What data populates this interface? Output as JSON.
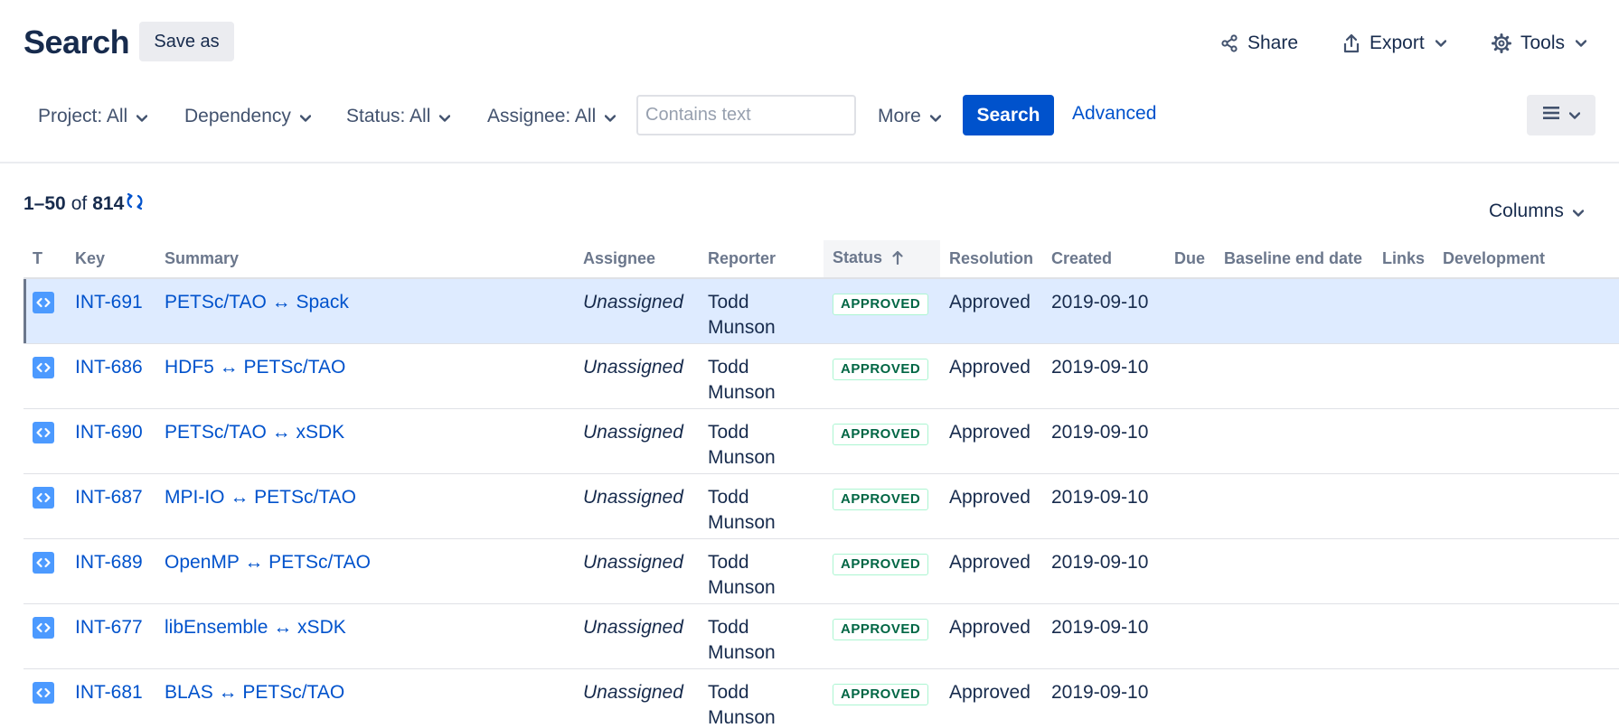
{
  "header": {
    "title": "Search",
    "save_as": "Save as",
    "share": "Share",
    "export": "Export",
    "tools": "Tools"
  },
  "filters": {
    "project": "Project: All",
    "dependency": "Dependency",
    "status": "Status: All",
    "assignee": "Assignee: All",
    "text_placeholder": "Contains text",
    "more": "More",
    "search": "Search",
    "advanced": "Advanced"
  },
  "results": {
    "range": "1–50",
    "of": "of",
    "total": "814",
    "columns_label": "Columns"
  },
  "table": {
    "headers": {
      "type": "T",
      "key": "Key",
      "summary": "Summary",
      "assignee": "Assignee",
      "reporter": "Reporter",
      "status": "Status",
      "resolution": "Resolution",
      "created": "Created",
      "due": "Due",
      "baseline": "Baseline end date",
      "links": "Links",
      "development": "Development"
    },
    "rows": [
      {
        "key": "INT-691",
        "summary": "PETSc/TAO ↔ Spack",
        "assignee": "Unassigned",
        "reporter_first": "Todd",
        "reporter_last": "Munson",
        "status": "APPROVED",
        "resolution": "Approved",
        "created": "2019-09-10"
      },
      {
        "key": "INT-686",
        "summary": "HDF5 ↔ PETSc/TAO",
        "assignee": "Unassigned",
        "reporter_first": "Todd",
        "reporter_last": "Munson",
        "status": "APPROVED",
        "resolution": "Approved",
        "created": "2019-09-10"
      },
      {
        "key": "INT-690",
        "summary": "PETSc/TAO ↔ xSDK",
        "assignee": "Unassigned",
        "reporter_first": "Todd",
        "reporter_last": "Munson",
        "status": "APPROVED",
        "resolution": "Approved",
        "created": "2019-09-10"
      },
      {
        "key": "INT-687",
        "summary": "MPI-IO ↔ PETSc/TAO",
        "assignee": "Unassigned",
        "reporter_first": "Todd",
        "reporter_last": "Munson",
        "status": "APPROVED",
        "resolution": "Approved",
        "created": "2019-09-10"
      },
      {
        "key": "INT-689",
        "summary": "OpenMP ↔ PETSc/TAO",
        "assignee": "Unassigned",
        "reporter_first": "Todd",
        "reporter_last": "Munson",
        "status": "APPROVED",
        "resolution": "Approved",
        "created": "2019-09-10"
      },
      {
        "key": "INT-677",
        "summary": "libEnsemble ↔ xSDK",
        "assignee": "Unassigned",
        "reporter_first": "Todd",
        "reporter_last": "Munson",
        "status": "APPROVED",
        "resolution": "Approved",
        "created": "2019-09-10"
      },
      {
        "key": "INT-681",
        "summary": "BLAS ↔ PETSc/TAO",
        "assignee": "Unassigned",
        "reporter_first": "Todd",
        "reporter_last": "Munson",
        "status": "APPROVED",
        "resolution": "Approved",
        "created": "2019-09-10"
      }
    ]
  },
  "colors": {
    "accent": "#0052cc",
    "selected_row": "#deebff",
    "status_green": "#006644"
  },
  "icons": {
    "issue_type": "code-brackets-icon",
    "share": "share-icon",
    "export": "export-icon",
    "tools": "gear-icon",
    "refresh": "refresh-icon",
    "view": "list-view-icon",
    "sort": "arrow-up-icon",
    "dropdown": "chevron-down-icon"
  }
}
